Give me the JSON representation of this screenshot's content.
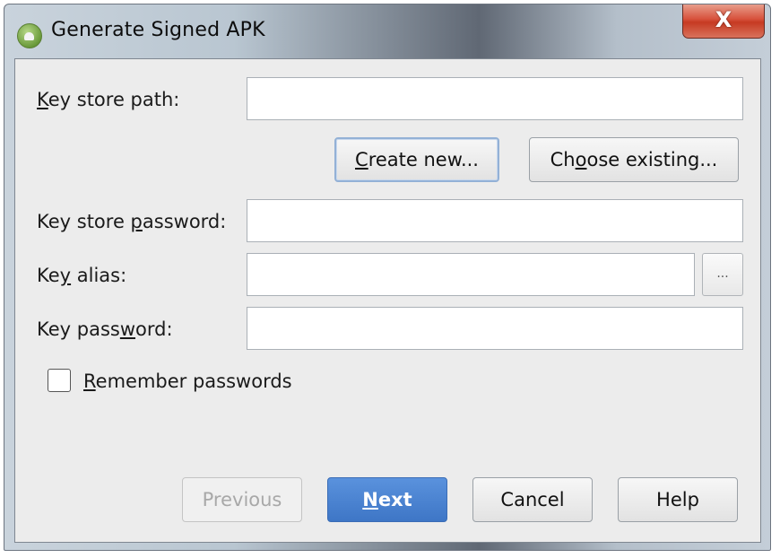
{
  "window": {
    "title": "Generate Signed APK",
    "close_label": "X"
  },
  "form": {
    "key_store_path": {
      "label_pre": "",
      "label_u": "K",
      "label_post": "ey store path:",
      "value": ""
    },
    "key_store_password": {
      "label_pre": "Key store ",
      "label_u": "p",
      "label_post": "assword:",
      "value": ""
    },
    "key_alias": {
      "label_pre": "Ke",
      "label_u": "y",
      "label_post": " alias:",
      "value": "",
      "browse_label": "..."
    },
    "key_password": {
      "label_pre": "Key pass",
      "label_u": "w",
      "label_post": "ord:",
      "value": ""
    },
    "remember": {
      "label_pre": "",
      "label_u": "R",
      "label_post": "emember passwords",
      "checked": false
    }
  },
  "keystore_buttons": {
    "create_pre": "",
    "create_u": "C",
    "create_post": "reate new...",
    "choose_pre": "Ch",
    "choose_u": "o",
    "choose_post": "ose existing..."
  },
  "footer": {
    "previous": "Previous",
    "next_u": "N",
    "next_post": "ext",
    "cancel": "Cancel",
    "help": "Help"
  }
}
